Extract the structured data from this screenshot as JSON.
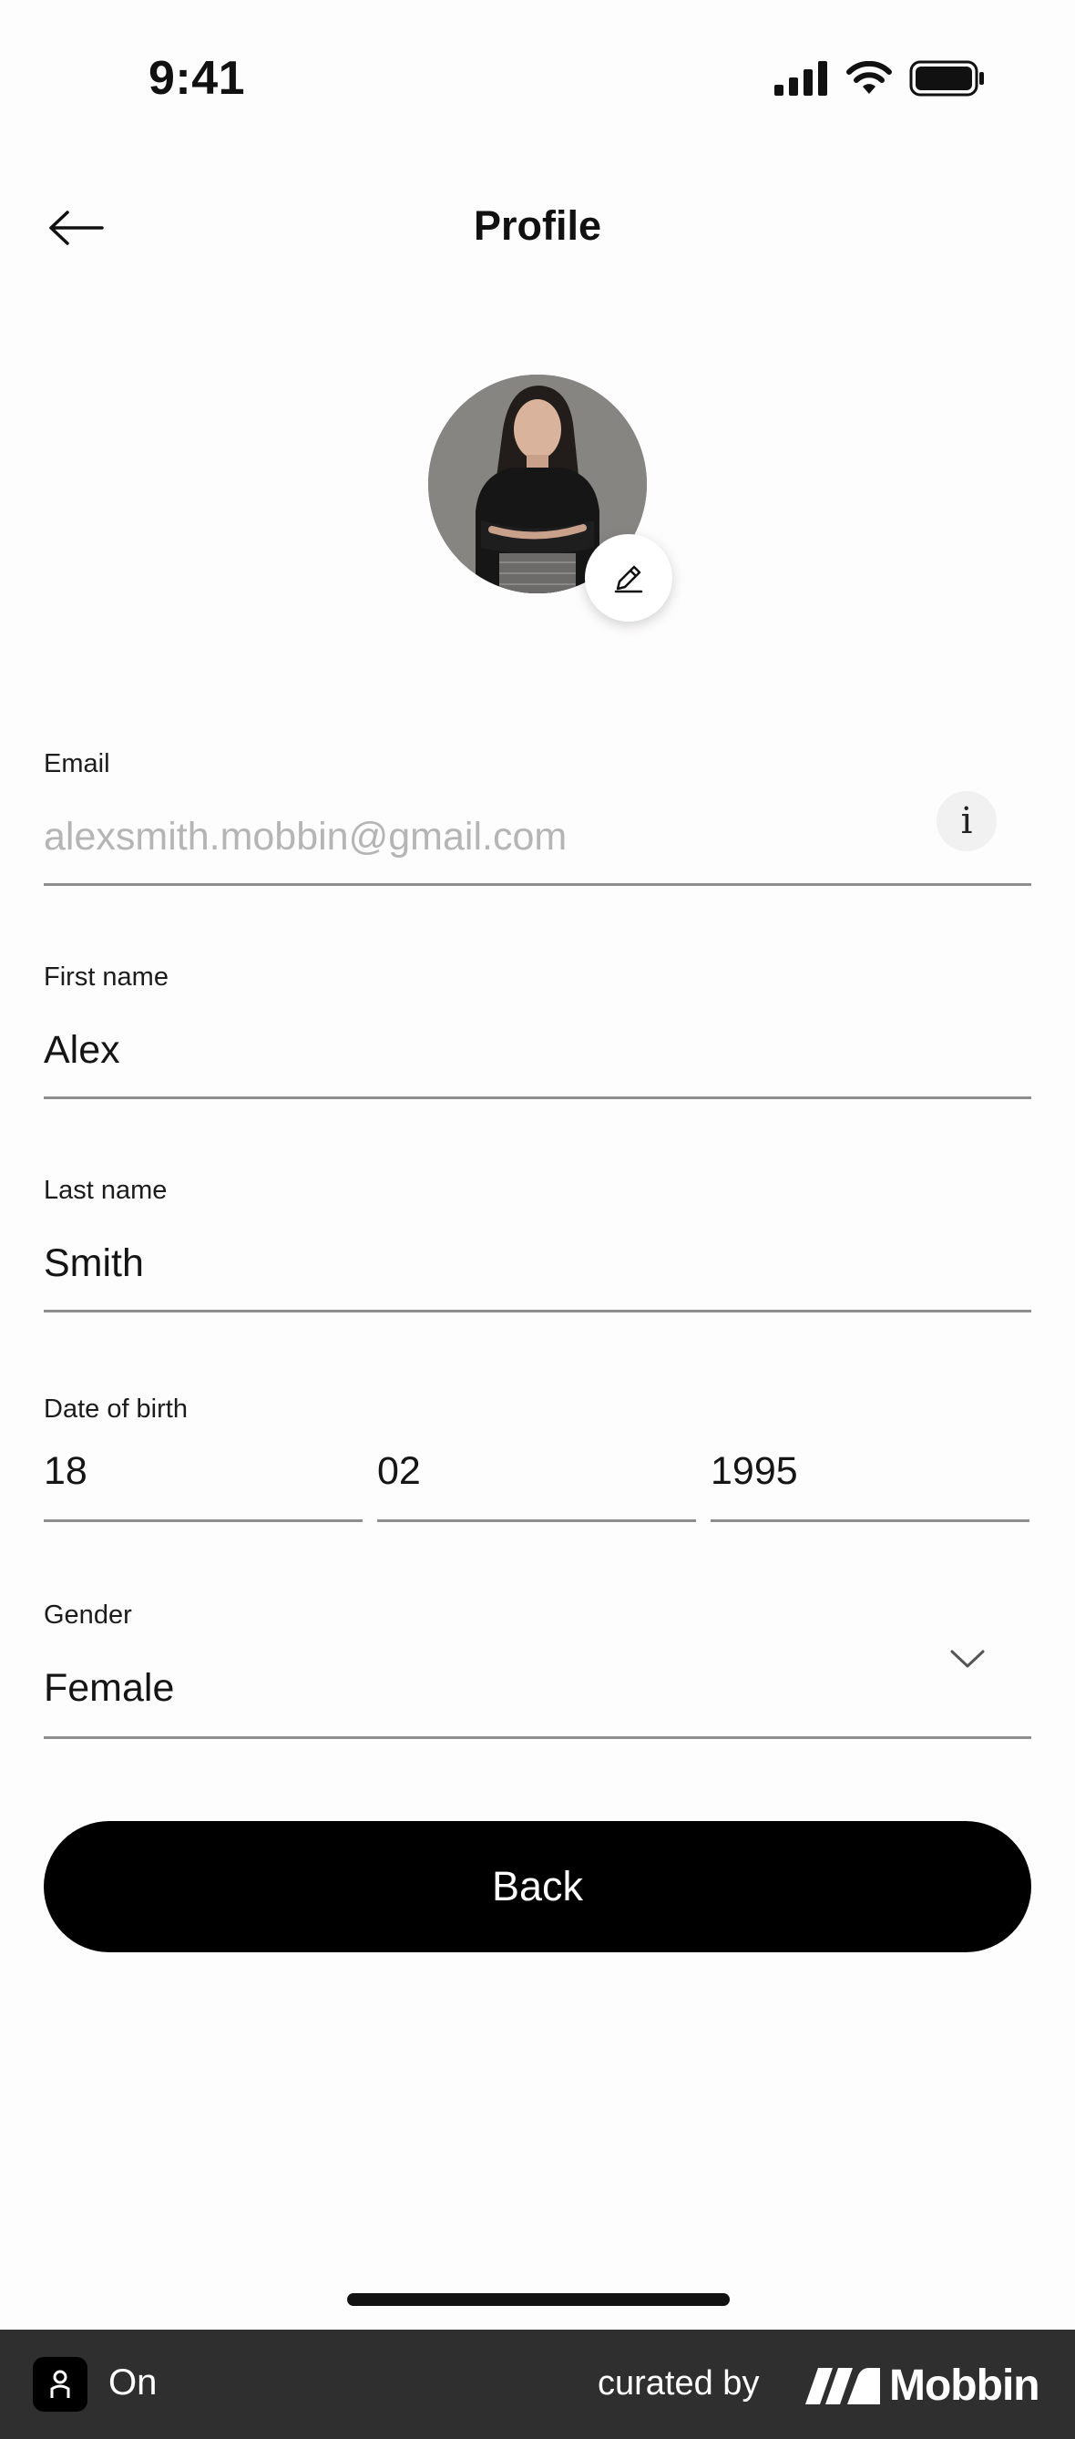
{
  "status_bar": {
    "time": "9:41"
  },
  "header": {
    "title": "Profile"
  },
  "fields": {
    "email": {
      "label": "Email",
      "value": "alexsmith.mobbin@gmail.com"
    },
    "first_name": {
      "label": "First name",
      "value": "Alex"
    },
    "last_name": {
      "label": "Last name",
      "value": "Smith"
    },
    "date_of_birth": {
      "label": "Date of birth",
      "day": "18",
      "month": "02",
      "year": "1995"
    },
    "gender": {
      "label": "Gender",
      "value": "Female"
    }
  },
  "info_glyph": "i",
  "actions": {
    "back_label": "Back"
  },
  "footer": {
    "app_name": "On",
    "curated_by": "curated by",
    "brand": "Mobbin"
  },
  "icons": {
    "back": "arrow-left-icon",
    "edit": "pencil-icon",
    "info": "info-icon",
    "dropdown": "chevron-down-icon",
    "signal": "cellular-signal-icon",
    "wifi": "wifi-icon",
    "battery": "battery-icon"
  }
}
